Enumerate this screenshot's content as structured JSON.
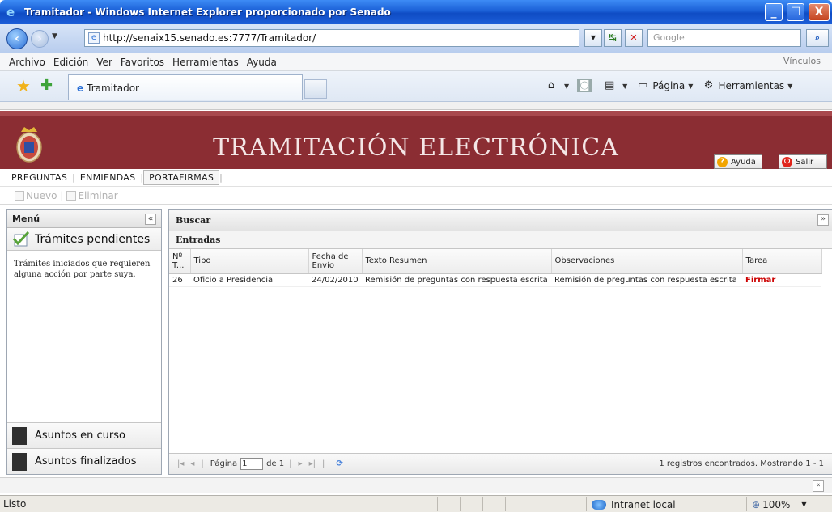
{
  "window": {
    "title": "Tramitador - Windows Internet Explorer proporcionado por Senado",
    "min_symbol": "_",
    "max_symbol": "☐",
    "close_symbol": "X"
  },
  "address_bar": {
    "url": "http://senaix15.senado.es:7777/Tramitador/",
    "search_placeholder": "Google"
  },
  "menu": {
    "items": [
      "Archivo",
      "Edición",
      "Ver",
      "Favoritos",
      "Herramientas",
      "Ayuda"
    ],
    "links": "Vínculos"
  },
  "tabs": {
    "active_label": "Tramitador"
  },
  "command_bar": {
    "page_label": "Página",
    "tools_label": "Herramientas"
  },
  "app": {
    "title": "TRAMITACIÓN ELECTRÓNICA",
    "help_label": "Ayuda",
    "exit_label": "Salir",
    "nav": [
      "PREGUNTAS",
      "ENMIENDAS",
      "PORTAFIRMAS"
    ],
    "active_nav": "PORTAFIRMAS",
    "toolbar": {
      "new_label": "Nuevo",
      "separator": "|",
      "delete_label": "Eliminar"
    }
  },
  "sidebar": {
    "header": "Menú",
    "collapse_symbol": "«",
    "pending_label": "Trámites pendientes",
    "pending_desc": "Trámites iniciados que requieren alguna acción por parte suya.",
    "in_progress_label": "Asuntos en curso",
    "finished_label": "Asuntos finalizados"
  },
  "main": {
    "search_label": "Buscar",
    "expand_symbol": "»",
    "section_label": "Entradas",
    "columns": [
      "Nº T...",
      "Tipo",
      "Fecha de Envío",
      "Texto Resumen",
      "Observaciones",
      "Tarea"
    ],
    "rows": [
      {
        "num": "26",
        "tipo": "Oficio a Presidencia",
        "fecha": "24/02/2010",
        "resumen": "Remisión de preguntas con respuesta escrita",
        "observaciones": "Remisión de preguntas con respuesta escrita",
        "tarea": "Firmar"
      }
    ]
  },
  "pager": {
    "page_label": "Página",
    "page_value": "1",
    "of_label": "de 1",
    "status": "1 registros encontrados. Mostrando 1 - 1"
  },
  "statusbar": {
    "status": "Listo",
    "zone": "Intranet local",
    "zoom": "100%"
  },
  "colors": {
    "header_bg": "#8b2d33",
    "task_color": "#cc0000",
    "titlebar": "#1a5fd6"
  }
}
